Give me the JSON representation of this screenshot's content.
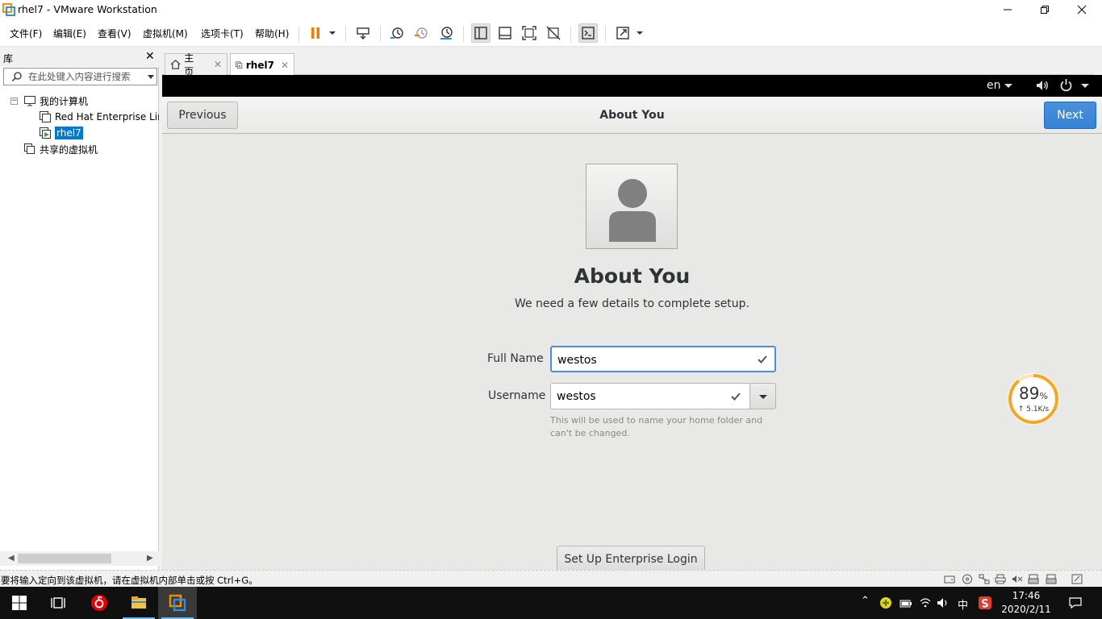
{
  "window": {
    "title": "rhel7 - VMware Workstation"
  },
  "menu": {
    "items": [
      "文件(F)",
      "编辑(E)",
      "查看(V)",
      "虚拟机(M)",
      "选项卡(T)",
      "帮助(H)"
    ]
  },
  "toolbar": {
    "icons": [
      "pause-icon",
      "send-ctrl-alt-del-icon",
      "snapshot-take-icon",
      "snapshot-revert-icon",
      "snapshot-manager-icon",
      "show-library-icon",
      "thumbnail-bar-icon",
      "full-screen-icon",
      "unity-icon",
      "console-view-icon",
      "stretch-guest-icon"
    ]
  },
  "library": {
    "header": "库",
    "close": "✕",
    "search_placeholder": "在此处键入内容进行搜索",
    "tree": {
      "root": "我的计算机",
      "vm1": "Red Hat Enterprise Linux",
      "vm2": "rhel7",
      "shared": "共享的虚拟机"
    }
  },
  "tabs": [
    {
      "label": "主页",
      "close": "✕"
    },
    {
      "label": "rhel7",
      "close": "✕"
    }
  ],
  "guest": {
    "topbar": {
      "lang": "en"
    },
    "header": {
      "title": "About You",
      "previous": "Previous",
      "next": "Next"
    },
    "page": {
      "heading": "About You",
      "subheading": "We need a few details to complete setup.",
      "fullname_label": "Full Name",
      "fullname_value": "westos",
      "username_label": "Username",
      "username_value": "westos",
      "hint": "This will be used to name your home folder and can't be changed.",
      "enterprise_button": "Set Up Enterprise Login"
    },
    "gauge": {
      "percent": "89",
      "percent_unit": "%",
      "speed": "↑ 5.1K/s",
      "value": 0.89
    }
  },
  "statusbar": {
    "message": "要将输入定向到该虚拟机，请在虚拟机内部单击或按 Ctrl+G。"
  },
  "taskbar": {
    "ime": "中",
    "time": "17:46",
    "date": "2020/2/11"
  },
  "colors": {
    "accent": "#0078d7",
    "next_button": "#3583d6",
    "gauge": "#f5a623"
  }
}
